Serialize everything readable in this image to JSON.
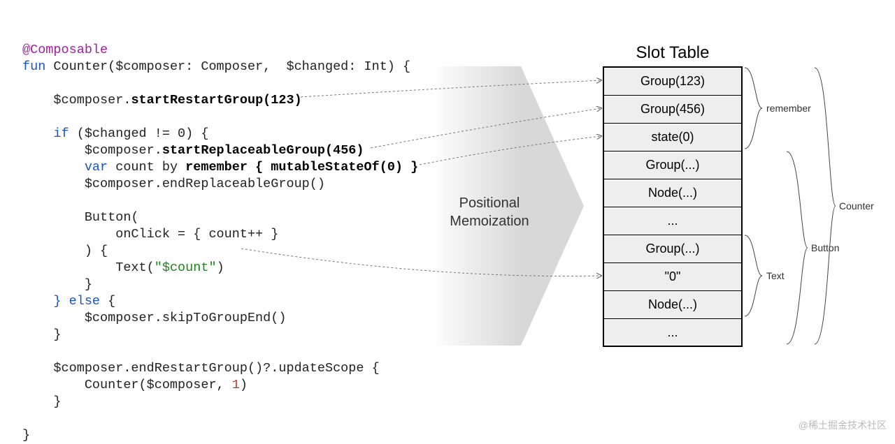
{
  "code": {
    "annotation": "@Composable",
    "fun": "fun",
    "sig1": " Counter($composer: Composer,  $changed: Int) {",
    "l1a": "    $composer.",
    "l1b": "startRestartGroup(",
    "l1num": "123",
    "l1c": ")",
    "if": "    if",
    "ifcond": " ($changed != 0) {",
    "l2a": "        $composer.",
    "l2b": "startReplaceableGroup(",
    "l2num": "456",
    "l2c": ")",
    "l3var": "        var",
    "l3mid": " count by ",
    "l3rem": "remember { mutableStateOf(",
    "l3zero": "0",
    "l3end": ") }",
    "l4": "        $composer.endReplaceableGroup()",
    "l5": "        Button(",
    "l6": "            onClick = { count++ }",
    "l7": "        ) {",
    "l8a": "            Text(",
    "l8str": "\"$count\"",
    "l8b": ")",
    "l9": "        }",
    "else": "    } else",
    "elseb": " {",
    "l10": "        $composer.skipToGroupEnd()",
    "l11": "    }",
    "l12": "    $composer.endRestartGroup()?.updateScope {",
    "l13a": "        Counter($composer, ",
    "l13num": "1",
    "l13b": ")",
    "l14": "    }",
    "l15": "}"
  },
  "arrow": {
    "line1": "Positional",
    "line2": "Memoization"
  },
  "slot": {
    "title": "Slot Table",
    "rows": [
      "Group(123)",
      "Group(456)",
      "state(0)",
      "Group(...)",
      "Node(...)",
      "...",
      "Group(...)",
      "\"0\"",
      "Node(...)",
      "..."
    ]
  },
  "labels": {
    "remember": "remember",
    "counter": "Counter",
    "button": "Button",
    "text": "Text"
  },
  "watermark": "@稀土掘金技术社区"
}
